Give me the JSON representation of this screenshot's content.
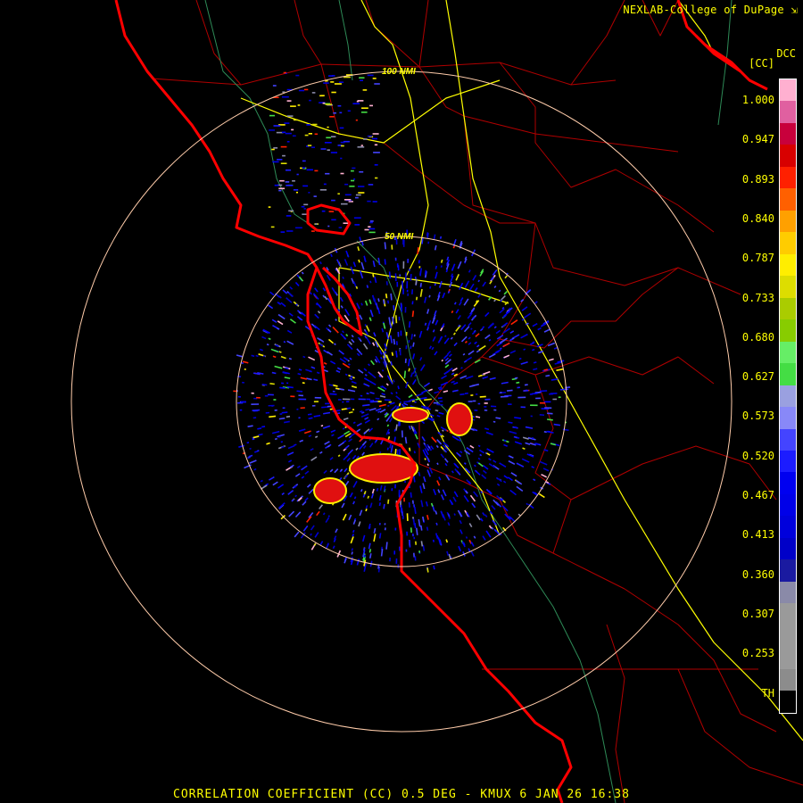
{
  "credit": "NEXLAB-College of DuPage",
  "corner_code": "DCC",
  "unit": "[CC]",
  "range_rings": [
    "100 NMI",
    "50 NMI"
  ],
  "scale_labels": [
    "1.000",
    "0.947",
    "0.893",
    "0.840",
    "0.787",
    "0.733",
    "0.680",
    "0.627",
    "0.573",
    "0.520",
    "0.467",
    "0.413",
    "0.360",
    "0.307",
    "0.253",
    "TH"
  ],
  "colors": {
    "coast": "#ff0000",
    "county": "#b00000",
    "highway": "#ffff00",
    "river": "#2e8b57",
    "ring": "#ffccaa",
    "scale": [
      "#000000",
      "#8c8c8c",
      "#9a9a9a",
      "#9a9a9a",
      "#9a9a9a",
      "#8a8aa8",
      "#1a1aa0",
      "#0000c8",
      "#0000dc",
      "#0000e8",
      "#0000f0",
      "#1c1cff",
      "#4444ff",
      "#8888f8",
      "#9aa0e0",
      "#44dd44",
      "#66ee66",
      "#88cc00",
      "#aacc00",
      "#dddd00",
      "#ffee00",
      "#ffcc00",
      "#ffa000",
      "#ff6000",
      "#ff2000",
      "#d80000",
      "#c8003c",
      "#e060a0",
      "#ffb0d0"
    ]
  },
  "footer": "CORRELATION COEFFICIENT (CC) 0.5 DEG - KMUX 6 JAN 26 16:38"
}
